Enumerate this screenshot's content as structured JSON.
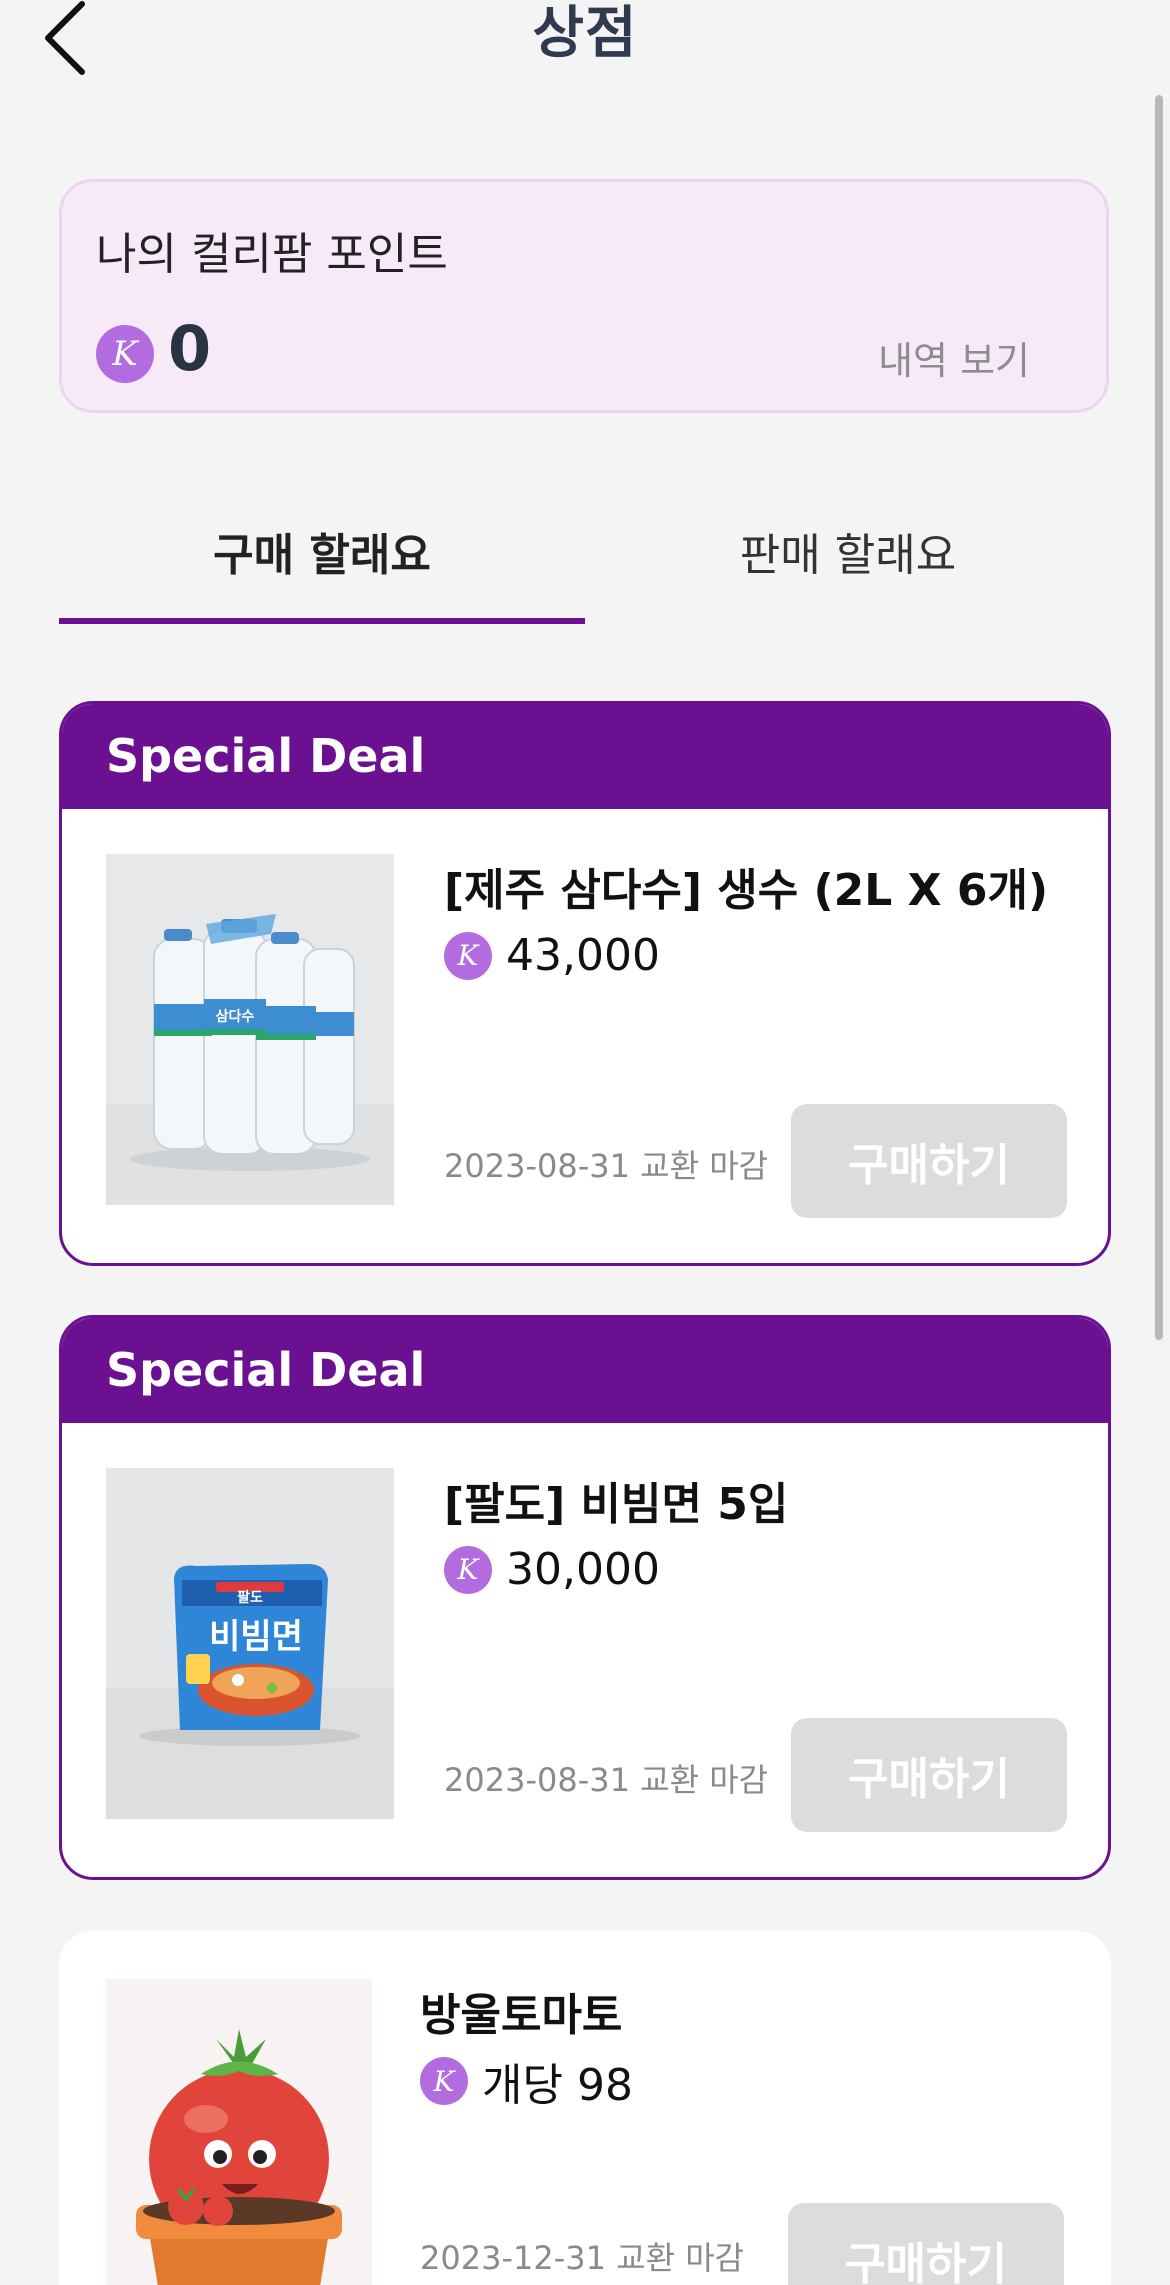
{
  "header": {
    "title": "상점",
    "back_icon": "chevron-left-icon"
  },
  "points": {
    "title": "나의 컬리팜 포인트",
    "currency_symbol": "K",
    "value": "0",
    "history_label": "내역 보기"
  },
  "tabs": [
    {
      "label": "구매 할래요",
      "active": true
    },
    {
      "label": "판매 할래요",
      "active": false
    }
  ],
  "products": [
    {
      "badge": "Special Deal",
      "name": "[제주 삼다수] 생수 (2L X 6개)",
      "currency_symbol": "K",
      "price": "43,000",
      "deadline": "2023-08-31 교환 마감",
      "button_label": "구매하기"
    },
    {
      "badge": "Special Deal",
      "name": "[팔도] 비빔면 5입",
      "currency_symbol": "K",
      "price": "30,000",
      "deadline": "2023-08-31 교환 마감",
      "button_label": "구매하기"
    },
    {
      "name": "방울토마토",
      "currency_symbol": "K",
      "price": "개당 98",
      "deadline": "2023-12-31 교환 마감",
      "button_label": "구매하기"
    }
  ],
  "product_images": {
    "water_label": "삼다수",
    "noodle_brand": "팔도",
    "noodle_label": "비빔면"
  },
  "colors": {
    "accent": "#6a1090",
    "points_bg": "#f6e9f8",
    "badge": "#b36be0",
    "button_disabled": "#dcdcdc"
  }
}
